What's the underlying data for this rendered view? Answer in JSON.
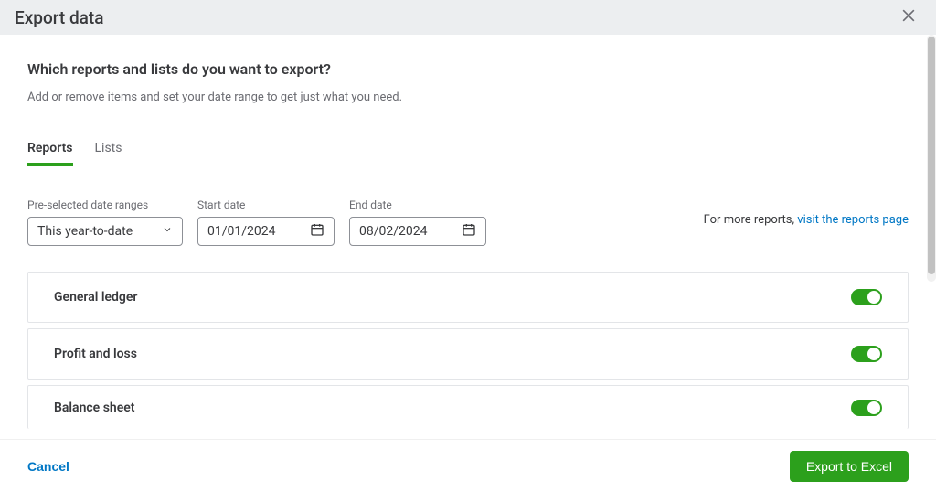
{
  "header": {
    "title": "Export data"
  },
  "question": "Which reports and lists do you want to export?",
  "subtext": "Add or remove items and set your date range to get just what you need.",
  "tabs": [
    {
      "label": "Reports",
      "active": true
    },
    {
      "label": "Lists",
      "active": false
    }
  ],
  "fields": {
    "preselected": {
      "label": "Pre-selected date ranges",
      "value": "This year-to-date"
    },
    "start": {
      "label": "Start date",
      "value": "01/01/2024"
    },
    "end": {
      "label": "End date",
      "value": "08/02/2024"
    }
  },
  "more_reports_prefix": "For more reports, ",
  "more_reports_link": "visit the reports page",
  "items": [
    {
      "label": "General ledger",
      "on": true
    },
    {
      "label": "Profit and loss",
      "on": true
    },
    {
      "label": "Balance sheet",
      "on": true
    }
  ],
  "footer": {
    "cancel": "Cancel",
    "export": "Export to Excel"
  }
}
